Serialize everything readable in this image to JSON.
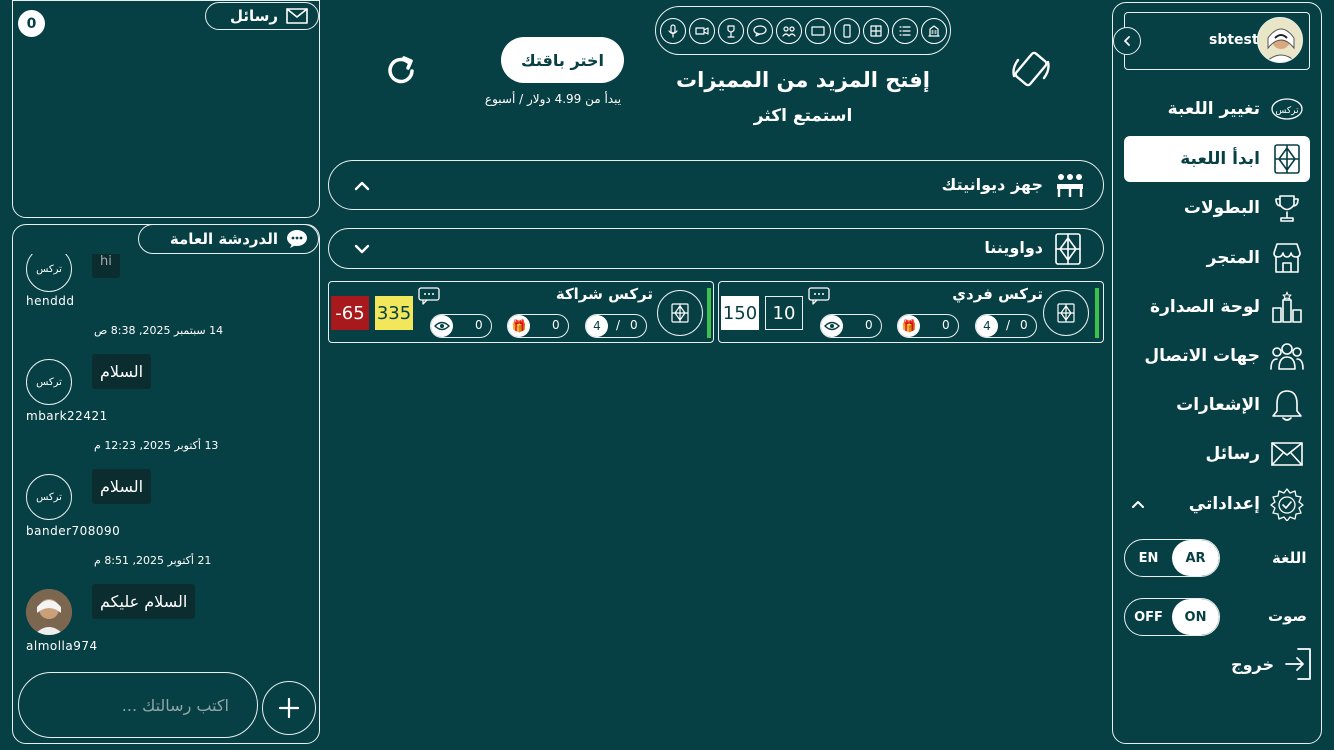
{
  "profile": {
    "username": "sbtest"
  },
  "sidebar": {
    "items": [
      {
        "key": "change-game",
        "label": "تغيير اللعبة",
        "icon": "tarkes-logo-icon"
      },
      {
        "key": "start-game",
        "label": "ابدأ اللعبة",
        "icon": "game-board-icon",
        "active": true
      },
      {
        "key": "tournaments",
        "label": "البطولات",
        "icon": "trophy-icon"
      },
      {
        "key": "store",
        "label": "المتجر",
        "icon": "store-icon"
      },
      {
        "key": "leaderboard",
        "label": "لوحة الصدارة",
        "icon": "leaderboard-icon"
      },
      {
        "key": "contacts",
        "label": "جهات الاتصال",
        "icon": "contacts-icon"
      },
      {
        "key": "notifications",
        "label": "الإشعارات",
        "icon": "bell-icon"
      },
      {
        "key": "messages",
        "label": "رسائل",
        "icon": "envelope-icon"
      },
      {
        "key": "settings",
        "label": "إعداداتي",
        "icon": "gear-icon"
      }
    ],
    "language_label": "اللغة",
    "lang_en": "EN",
    "lang_ar": "AR",
    "sound_label": "صوت",
    "sound_off": "OFF",
    "sound_on": "ON",
    "logout_label": "خروج"
  },
  "promo": {
    "title": "إفتح المزيد من المميزات",
    "subtitle": "استمتع اكثر",
    "choose_button": "اختر باقتك",
    "price_note": "يبدأ من 4.99 دولار / أسبوع"
  },
  "sections": {
    "prepare_diwan": "جهز ديوانيتك",
    "our_diwans": "دواويننا"
  },
  "rooms": [
    {
      "title": "تركس فردي",
      "players": "0",
      "players_max": "4",
      "divider": "/",
      "gifts": "0",
      "views": "0",
      "score_a": "10",
      "score_b": "150",
      "status_color": "#3cc24b"
    },
    {
      "title": "تركس شراكة",
      "players": "0",
      "players_max": "4",
      "divider": "/",
      "gifts": "0",
      "views": "0",
      "score_a": "335",
      "score_b": "-65",
      "score_a_color": "#f2e65a",
      "score_b_color": "#a7191c",
      "status_color": "#3cc24b"
    }
  ],
  "messages_panel": {
    "title": "رسائل",
    "count": "0"
  },
  "chat": {
    "title": "الدردشة العامة",
    "partial_text": "hi",
    "entries": [
      {
        "user": "henddd"
      },
      {
        "time": "14 سبتمبر 2025, 8:38 ص",
        "text": "السلام",
        "user": "mbark22421"
      },
      {
        "time": "13 أكتوبر 2025, 12:23 م",
        "text": "السلام",
        "user": "bander708090"
      },
      {
        "time": "21 أكتوبر 2025, 8:51 م",
        "text": "السلام عليكم",
        "user": "almolla974"
      }
    ],
    "avatar_logo": "تركس",
    "input_placeholder": "اكتب رسالتك ..."
  },
  "colors": {
    "background": "#063f44",
    "bubble": "#0b2d2f",
    "border": "#e8efee"
  }
}
